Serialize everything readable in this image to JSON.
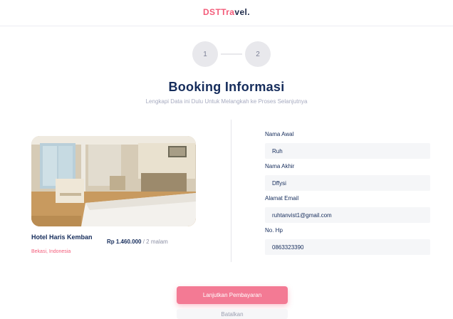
{
  "navbar": {
    "logo_part1": "DSTTra",
    "logo_part2": "vel."
  },
  "stepper": {
    "steps": [
      {
        "label": "1"
      },
      {
        "label": "2"
      }
    ]
  },
  "page": {
    "title": "Booking Informasi",
    "subtitle": "Lengkapi Data ini Dulu Untuk Melangkah ke Proses Selanjutnya"
  },
  "hotel": {
    "name": "Hotel Haris Kemban",
    "location": "Bekasi, Indonesia",
    "price_amount": "Rp 1.460.000",
    "price_suffix": "/ 2 malam"
  },
  "form": {
    "first_name": {
      "label": "Nama Awal",
      "value": "Ruh"
    },
    "last_name": {
      "label": "Nama Akhir",
      "value": "Dffysi"
    },
    "email": {
      "label": "Alamat Email",
      "value": "ruhtanvist1@gmail.com"
    },
    "phone": {
      "label": "No. Hp",
      "value": "0863323390"
    }
  },
  "actions": {
    "continue_label": "Lanjutkan Pembayaran",
    "cancel_label": "Batalkan"
  },
  "colors": {
    "accent": "#f35c7a",
    "primary_text": "#152c5b",
    "input_bg": "#f5f6f8"
  }
}
